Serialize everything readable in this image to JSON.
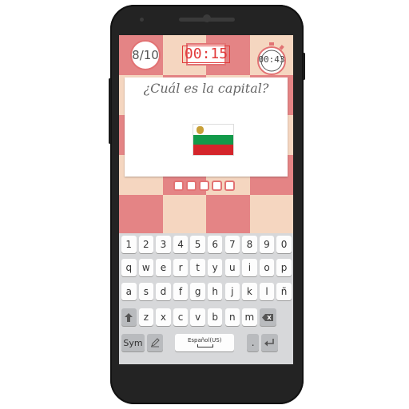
{
  "game": {
    "score": "8/10",
    "countdown": "00:15",
    "elapsed": "00:43",
    "question": "¿Cuál es la capital?",
    "answer_slots": 5,
    "flag_icon": "bulgaria-flag-icon"
  },
  "colors": {
    "board_dark": "#e48485",
    "board_light": "#f5d6c0",
    "accent": "#e27273",
    "timer_text": "#e23b3b",
    "flag_white": "#ffffff",
    "flag_green": "#129a4a",
    "flag_red": "#d4252b"
  },
  "keyboard": {
    "row_numbers": [
      "1",
      "2",
      "3",
      "4",
      "5",
      "6",
      "7",
      "8",
      "9",
      "0"
    ],
    "row_top": [
      "q",
      "w",
      "e",
      "r",
      "t",
      "y",
      "u",
      "i",
      "o",
      "p"
    ],
    "row_home": [
      "a",
      "s",
      "d",
      "f",
      "g",
      "h",
      "j",
      "k",
      "l",
      "ñ"
    ],
    "row_bottom": [
      "z",
      "x",
      "c",
      "v",
      "b",
      "n",
      "m"
    ],
    "shift_icon": "shift-arrow-icon",
    "backspace_icon": "backspace-icon",
    "sym_label": "Sym",
    "handwriting_icon": "handwriting-pen-icon",
    "space_label": "Español(US)",
    "period_label": ".",
    "enter_icon": "enter-icon"
  }
}
